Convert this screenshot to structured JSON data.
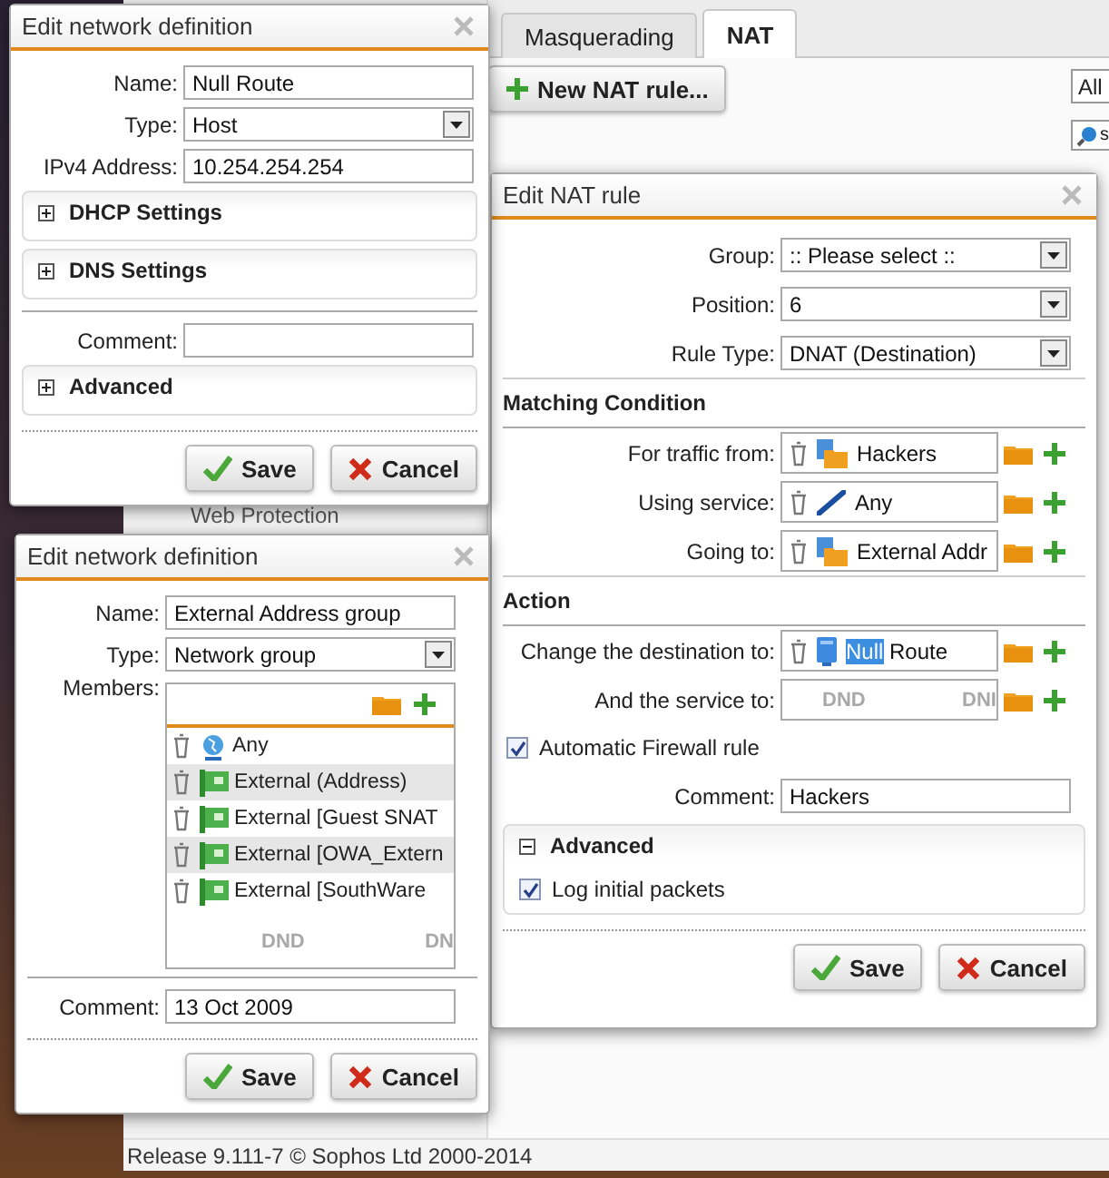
{
  "tabs": [
    {
      "label": "Masquerading",
      "selected": false
    },
    {
      "label": "NAT",
      "selected": true
    }
  ],
  "new_rule_button": "New NAT rule...",
  "filter": {
    "value": "All"
  },
  "search": {
    "value": "s"
  },
  "sidebar_item": "Web Protection",
  "network_dialogs": [
    {
      "title": "Edit network definition",
      "rows": [
        {
          "kind": "text",
          "label": "Name:",
          "value": "Null Route"
        },
        {
          "kind": "select",
          "label": "Type:",
          "value": "Host"
        },
        {
          "kind": "text",
          "label": "IPv4 Address:",
          "value": "10.254.254.254"
        },
        {
          "kind": "panel",
          "label": "DHCP Settings",
          "expanded": false
        },
        {
          "kind": "panel",
          "label": "DNS Settings",
          "expanded": false
        },
        {
          "kind": "separator"
        },
        {
          "kind": "text",
          "label": "Comment:"
        },
        {
          "kind": "panel",
          "label": "Advanced",
          "expanded": false
        }
      ],
      "buttons": [
        "Save",
        "Cancel"
      ]
    },
    {
      "title": "Edit network definition",
      "rows": [
        {
          "kind": "text",
          "label": "Name:",
          "value": "External Address group"
        },
        {
          "kind": "select",
          "label": "Type:",
          "value": "Network group"
        },
        {
          "kind": "members",
          "label": "Members:",
          "items": [
            {
              "kind": "any",
              "label": "Any"
            },
            {
              "kind": "network",
              "label": "External (Address)"
            },
            {
              "kind": "network",
              "label": "External [Guest SNAT"
            },
            {
              "kind": "network",
              "label": "External [OWA_Extern"
            },
            {
              "kind": "network",
              "label": "External [SouthWare"
            }
          ],
          "placeholders": [
            "DND",
            "DN"
          ]
        },
        {
          "kind": "separator"
        },
        {
          "kind": "text",
          "label": "Comment:",
          "value": "13 Oct 2009"
        }
      ],
      "buttons": [
        "Save",
        "Cancel"
      ]
    }
  ],
  "nat_dialog": {
    "title": "Edit NAT rule",
    "rows": [
      {
        "kind": "select",
        "label": "Group:",
        "value": ":: Please select ::"
      },
      {
        "kind": "select",
        "label": "Position:",
        "value": "6"
      },
      {
        "kind": "select",
        "label": "Rule Type:",
        "value": "DNAT (Destination)"
      },
      {
        "kind": "heading",
        "label": "Matching Condition"
      },
      {
        "kind": "group_object",
        "label": "For traffic from:",
        "value": "Hackers"
      },
      {
        "kind": "service_object",
        "label": "Using service:",
        "value": "Any"
      },
      {
        "kind": "group_object",
        "label": "Going to:",
        "value": "External Addr"
      },
      {
        "kind": "heading",
        "label": "Action"
      },
      {
        "kind": "host_object",
        "label": "Change the destination to:",
        "selected_text": "Null",
        "value": "Route"
      },
      {
        "kind": "empty_object",
        "label": "And the service to:",
        "placeholders": [
          "DND",
          "DNI"
        ]
      },
      {
        "kind": "checkbox",
        "label": "Automatic Firewall rule",
        "checked": true
      },
      {
        "kind": "text",
        "label": "Comment:",
        "value": "Hackers"
      },
      {
        "kind": "panel",
        "label": "Advanced",
        "expanded": true,
        "options": [
          {
            "label": "Log initial packets",
            "checked": true
          }
        ]
      }
    ],
    "buttons": [
      "Save",
      "Cancel"
    ]
  },
  "status_bar": "Release 9.111-7 © Sophos Ltd 2000-2014"
}
